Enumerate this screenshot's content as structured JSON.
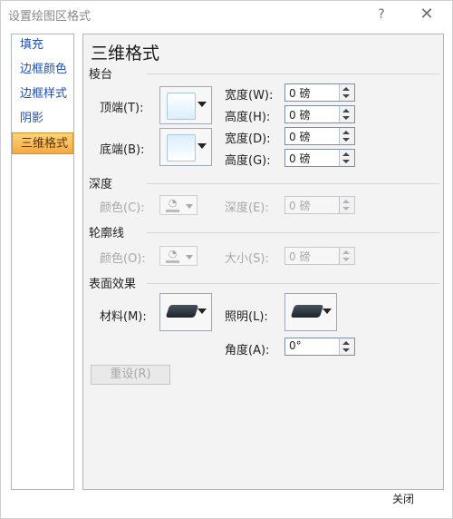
{
  "window": {
    "title": "设置绘图区格式",
    "help_glyph": "?",
    "close_glyph": "✕"
  },
  "nav": {
    "items": [
      "填充",
      "边框颜色",
      "边框样式",
      "阴影",
      "三维格式"
    ],
    "active_index": 4
  },
  "panel": {
    "title": "三维格式",
    "bevel": {
      "section": "棱台",
      "top_label": "顶端(T):",
      "bottom_label": "底端(B):",
      "top_width_label": "宽度(W):",
      "top_width_value": "0 磅",
      "top_height_label": "高度(H):",
      "top_height_value": "0 磅",
      "bottom_width_label": "宽度(D):",
      "bottom_width_value": "0 磅",
      "bottom_height_label": "高度(G):",
      "bottom_height_value": "0 磅"
    },
    "depth": {
      "section": "深度",
      "color_label": "颜色(C):",
      "depth_label": "深度(E):",
      "depth_value": "0 磅"
    },
    "contour": {
      "section": "轮廓线",
      "color_label": "颜色(O):",
      "size_label": "大小(S):",
      "size_value": "0 磅"
    },
    "surface": {
      "section": "表面效果",
      "material_label": "材料(M):",
      "lighting_label": "照明(L):",
      "angle_label": "角度(A):",
      "angle_value": "0°"
    },
    "reset_label": "重设(R)"
  },
  "footer": {
    "close_label": "关闭"
  },
  "colors": {
    "accent_active": "#f4a942",
    "nav_text": "#1e4fb3",
    "panel_bg": "#f3f3f3",
    "border": "#aeb6c3"
  }
}
